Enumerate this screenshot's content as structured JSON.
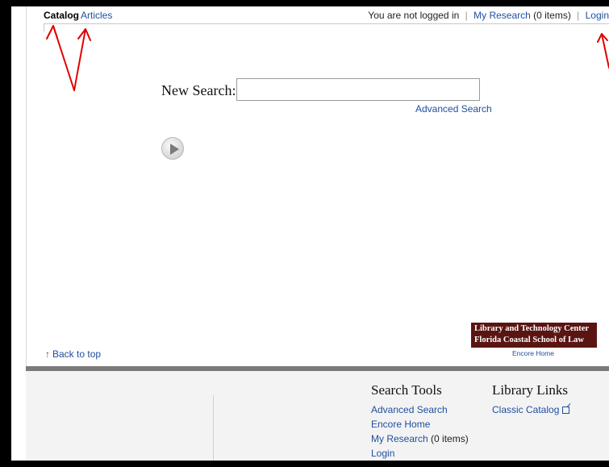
{
  "tabs": {
    "catalog": "Catalog",
    "articles": "Articles"
  },
  "user_bar": {
    "status": "You are not logged in",
    "my_research": "My Research",
    "items": "(0 items)",
    "login": "Login",
    "separator": "|"
  },
  "search": {
    "label": "New Search:",
    "value": "",
    "advanced_link": "Advanced Search"
  },
  "logo": {
    "line1": "Library and Technology Center",
    "line2": "Florida Coastal School of Law",
    "encore_home": "Encore Home"
  },
  "back_to_top": "Back to top",
  "footer": {
    "search_tools": {
      "heading": "Search Tools",
      "links": [
        "Advanced Search",
        "Encore Home",
        "My Research",
        "Login"
      ],
      "my_research_count": "(0 items)"
    },
    "library_links": {
      "heading": "Library Links",
      "links": [
        "Classic Catalog"
      ]
    }
  },
  "colors": {
    "link": "#1f4e9e",
    "logo_bg": "#5a1512",
    "annotation": "#e00000"
  }
}
